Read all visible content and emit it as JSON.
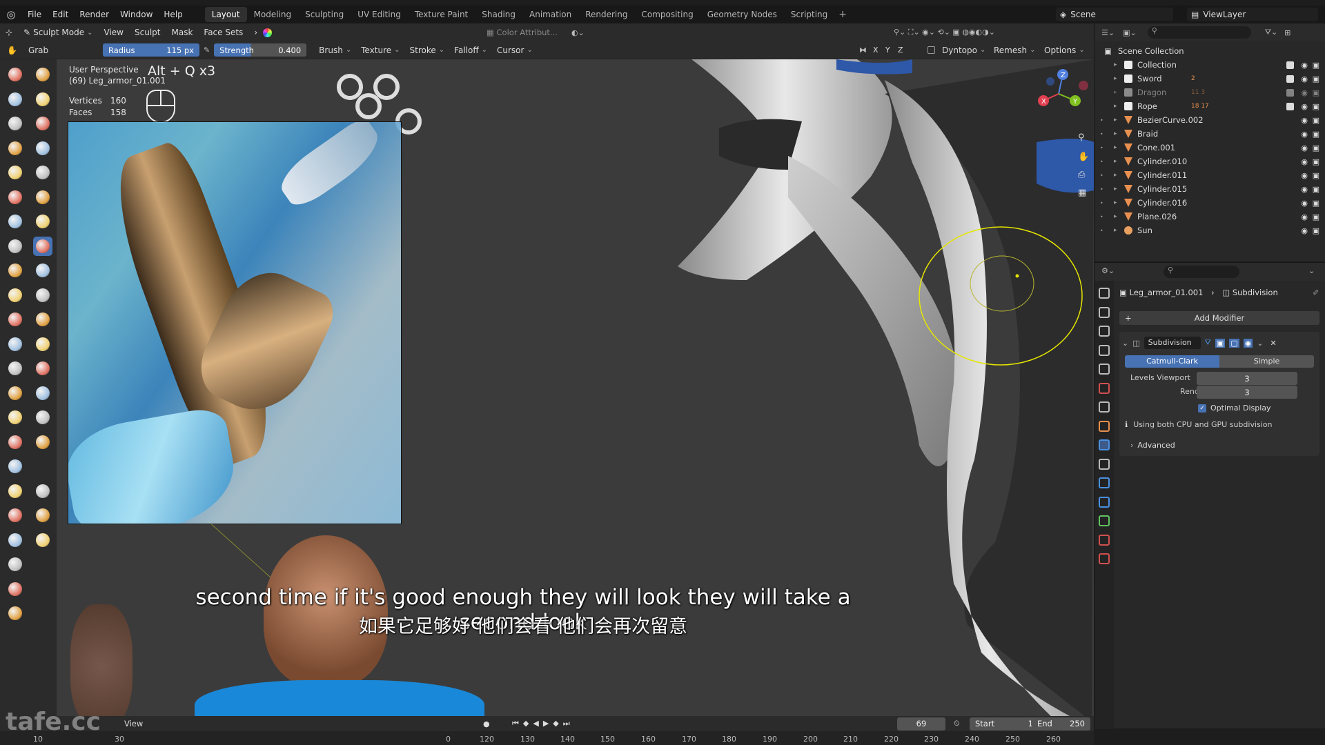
{
  "menubar": {
    "menus": [
      "File",
      "Edit",
      "Render",
      "Window",
      "Help"
    ],
    "workspaces": [
      "Layout",
      "Modeling",
      "Sculpting",
      "UV Editing",
      "Texture Paint",
      "Shading",
      "Animation",
      "Rendering",
      "Compositing",
      "Geometry Nodes",
      "Scripting"
    ],
    "active_workspace": "Layout",
    "scene": "Scene",
    "view_layer": "ViewLayer"
  },
  "header": {
    "mode": "Sculpt Mode",
    "menus": [
      "View",
      "Sculpt",
      "Mask",
      "Face Sets"
    ],
    "color_attribute": "Color Attribut..."
  },
  "tool_settings": {
    "tool_name": "Grab",
    "radius_label": "Radius",
    "radius_value": "115 px",
    "strength_label": "Strength",
    "strength_value": "0.400",
    "menus": [
      "Brush",
      "Texture",
      "Stroke",
      "Falloff",
      "Cursor"
    ],
    "axes": [
      "X",
      "Y",
      "Z"
    ],
    "dyntopo": "Dyntopo",
    "remesh": "Remesh",
    "options": "Options"
  },
  "viewport": {
    "perspective": "User Perspective",
    "object": "(69) Leg_armor_01.001",
    "shortcut_hint": "Alt + Q x3",
    "stats": {
      "vertices_label": "Vertices",
      "vertices": "160",
      "faces_label": "Faces",
      "faces": "158"
    },
    "gizmo_axes": [
      "Z",
      "X",
      "Y"
    ]
  },
  "subtitles": {
    "english": "second time if it's good enough they will look they will take a second look",
    "chinese": "如果它足够好 他们会看 他们会再次留意"
  },
  "watermark": "tafe.cc",
  "outliner": {
    "root": "Scene Collection",
    "items": [
      {
        "name": "Collection",
        "type": "collection",
        "dim": false
      },
      {
        "name": "Sword",
        "type": "collection",
        "dim": false,
        "count": "2"
      },
      {
        "name": "Dragon",
        "type": "collection",
        "dim": true,
        "count": "11 3"
      },
      {
        "name": "Rope",
        "type": "collection",
        "dim": false,
        "count": "18 17"
      },
      {
        "name": "BezierCurve.002",
        "type": "object",
        "dim": false
      },
      {
        "name": "Braid",
        "type": "object",
        "dim": false
      },
      {
        "name": "Cone.001",
        "type": "object",
        "dim": false
      },
      {
        "name": "Cylinder.010",
        "type": "object",
        "dim": false
      },
      {
        "name": "Cylinder.011",
        "type": "object",
        "dim": false
      },
      {
        "name": "Cylinder.015",
        "type": "object",
        "dim": false
      },
      {
        "name": "Cylinder.016",
        "type": "object",
        "dim": false
      },
      {
        "name": "Plane.026",
        "type": "object",
        "dim": false
      },
      {
        "name": "Sun",
        "type": "light",
        "dim": false
      }
    ]
  },
  "properties": {
    "object": "Leg_armor_01.001",
    "modifier_crumb": "Subdivision",
    "add_modifier": "Add Modifier",
    "modifier_name": "Subdivision",
    "catmull_clark": "Catmull-Clark",
    "simple": "Simple",
    "levels_viewport_label": "Levels Viewport",
    "levels_viewport": "3",
    "render_label": "Render",
    "render": "3",
    "optimal_display": "Optimal Display",
    "optimal_display_checked": true,
    "info": "Using both CPU and GPU subdivision",
    "advanced": "Advanced"
  },
  "timeline": {
    "view": "View",
    "current_frame": "69",
    "start_label": "Start",
    "start": "1",
    "end_label": "End",
    "end": "250",
    "ticks": [
      "10",
      "30",
      "0",
      "120",
      "130",
      "140",
      "150",
      "160",
      "170",
      "180",
      "190",
      "200",
      "210",
      "220",
      "230",
      "240",
      "250",
      "260"
    ]
  },
  "colors": {
    "accent_blue": "#4772b3",
    "brush_circle": "#e6e600",
    "viewport_bg": "#3b3b3b"
  }
}
